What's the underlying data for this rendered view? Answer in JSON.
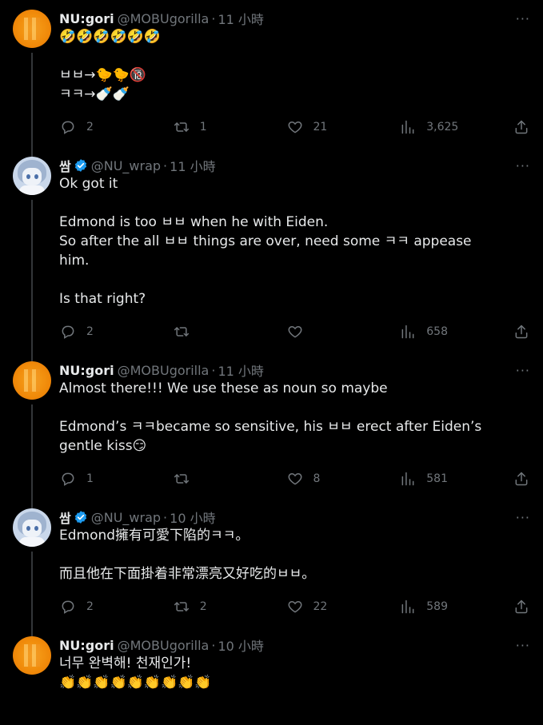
{
  "tweets": [
    {
      "author": "NU:gori",
      "handle": "@MOBUgorilla",
      "time": "11 小時",
      "verified": false,
      "lines": [
        "🤣🤣🤣🤣🤣🤣",
        "",
        "ㅂㅂ→🐤🐤🔞",
        "ㅋㅋ→🍼🍼"
      ],
      "replies": "2",
      "reposts": "1",
      "likes": "21",
      "views": "3,625"
    },
    {
      "author": "쌈",
      "handle": "@NU_wrap",
      "time": "11 小時",
      "verified": true,
      "lines": [
        "Ok got it",
        "",
        "Edmond is too ㅂㅂ when he with Eiden.",
        "So after the all ㅂㅂ things are over, need some ㅋㅋ appease",
        "him.",
        "",
        "Is that right?"
      ],
      "replies": "2",
      "reposts": "",
      "likes": "",
      "views": "658"
    },
    {
      "author": "NU:gori",
      "handle": "@MOBUgorilla",
      "time": "11 小時",
      "verified": false,
      "lines": [
        "Almost there!!! We use these as noun so maybe",
        "",
        "Edmond’s ㅋㅋbecame so sensitive, his ㅂㅂ erect after Eiden’s",
        "gentle kiss😏"
      ],
      "replies": "1",
      "reposts": "",
      "likes": "8",
      "views": "581"
    },
    {
      "author": "쌈",
      "handle": "@NU_wrap",
      "time": "10 小時",
      "verified": true,
      "lines": [
        "Edmond擁有可愛下陷的ㅋㅋ。",
        "",
        "而且他在下面掛着非常漂亮又好吃的ㅂㅂ。"
      ],
      "replies": "2",
      "reposts": "2",
      "likes": "22",
      "views": "589"
    },
    {
      "author": "NU:gori",
      "handle": "@MOBUgorilla",
      "time": "10 小時",
      "verified": false,
      "lines": [
        "너무 완벽해! 천재인가!",
        "👏👏👏👏👏👏👏👏👏"
      ]
    }
  ],
  "icons": {
    "reply": "reply-icon",
    "repost": "repost-icon",
    "like": "heart-icon",
    "views": "views-icon",
    "share": "share-icon",
    "more": "more-icon",
    "verified": "verified-badge-icon"
  },
  "colors": {
    "background": "#000000",
    "text": "#e7e9ea",
    "muted": "#71767b",
    "verified": "#1d9bf0",
    "border": "#2f3336"
  }
}
